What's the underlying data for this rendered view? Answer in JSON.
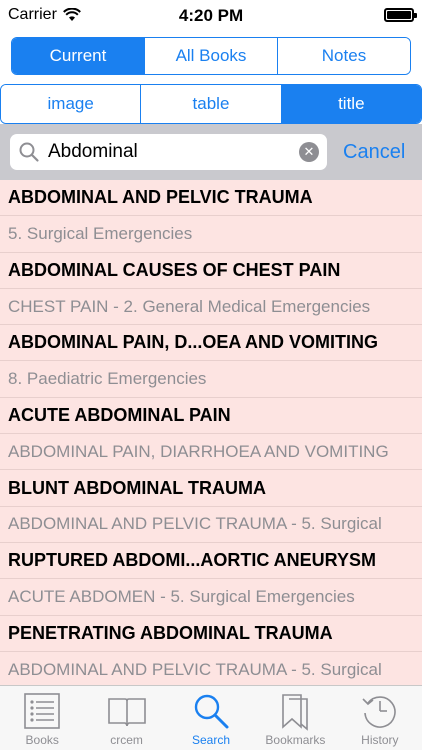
{
  "status": {
    "carrier": "Carrier",
    "time": "4:20 PM"
  },
  "top_segments": [
    {
      "label": "Current",
      "active": true
    },
    {
      "label": "All Books",
      "active": false
    },
    {
      "label": "Notes",
      "active": false
    }
  ],
  "type_segments": [
    {
      "label": "image",
      "active": false
    },
    {
      "label": "table",
      "active": false
    },
    {
      "label": "title",
      "active": true
    }
  ],
  "search": {
    "value": "Abdominal",
    "cancel_label": "Cancel"
  },
  "results": [
    {
      "title": "ABDOMINAL AND PELVIC TRAUMA",
      "subtitle": "5. Surgical Emergencies"
    },
    {
      "title": "ABDOMINAL CAUSES OF CHEST PAIN",
      "subtitle": "CHEST PAIN - 2. General Medical Emergencies"
    },
    {
      "title": "ABDOMINAL PAIN, D...OEA AND VOMITING",
      "subtitle": "8. Paediatric Emergencies"
    },
    {
      "title": "ACUTE ABDOMINAL PAIN",
      "subtitle": "ABDOMINAL PAIN, DIARRHOEA AND VOMITING"
    },
    {
      "title": "BLUNT ABDOMINAL TRAUMA",
      "subtitle": "ABDOMINAL AND PELVIC TRAUMA - 5. Surgical"
    },
    {
      "title": "RUPTURED ABDOMI...AORTIC ANEURYSM",
      "subtitle": "ACUTE ABDOMEN - 5. Surgical Emergencies"
    },
    {
      "title": "PENETRATING ABDOMINAL TRAUMA",
      "subtitle": "ABDOMINAL AND PELVIC TRAUMA - 5. Surgical"
    }
  ],
  "tabs": [
    {
      "label": "Books",
      "icon": "list-icon",
      "active": false
    },
    {
      "label": "crcem",
      "icon": "book-icon",
      "active": false
    },
    {
      "label": "Search",
      "icon": "search-icon",
      "active": true
    },
    {
      "label": "Bookmarks",
      "icon": "bookmarks-icon",
      "active": false
    },
    {
      "label": "History",
      "icon": "history-icon",
      "active": false
    }
  ],
  "colors": {
    "accent": "#1a80f0",
    "results_bg": "#fde4e2"
  }
}
